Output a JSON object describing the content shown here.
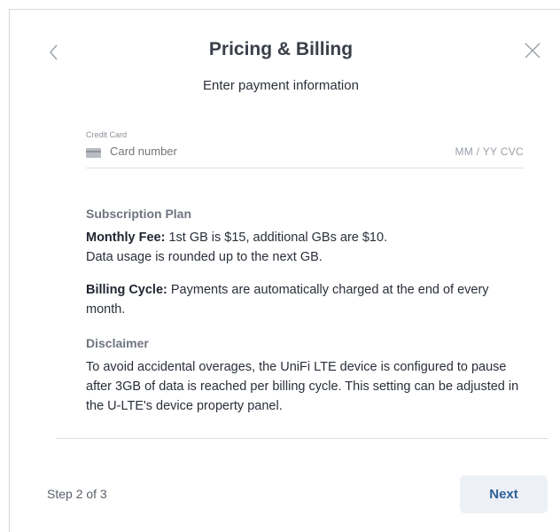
{
  "header": {
    "title": "Pricing & Billing",
    "subtitle": "Enter payment information"
  },
  "icons": {
    "back": "chevron-left-icon",
    "close": "close-icon",
    "card": "credit-card-icon"
  },
  "credit_card": {
    "label": "Credit Card",
    "number_placeholder": "Card number",
    "expiry_cvc_placeholder": "MM / YY  CVC"
  },
  "subscription": {
    "heading": "Subscription Plan",
    "monthly_fee_label": "Monthly Fee:",
    "monthly_fee_text": " 1st GB is $15, additional GBs are $10.",
    "rounding_text": "Data usage is rounded up to the next GB.",
    "billing_cycle_label": "Billing Cycle:",
    "billing_cycle_text": " Payments are automatically charged at the end of every month."
  },
  "disclaimer": {
    "heading": "Disclaimer",
    "text": "To avoid accidental overages, the UniFi LTE device is configured to pause after 3GB of data is reached per billing cycle. This setting can be adjusted in the U-LTE's device property panel."
  },
  "footer": {
    "step": "Step 2 of 3",
    "next_label": "Next"
  },
  "colors": {
    "primary_text": "#2c5f97",
    "button_bg": "#edf1f7",
    "muted": "#6f7580"
  }
}
